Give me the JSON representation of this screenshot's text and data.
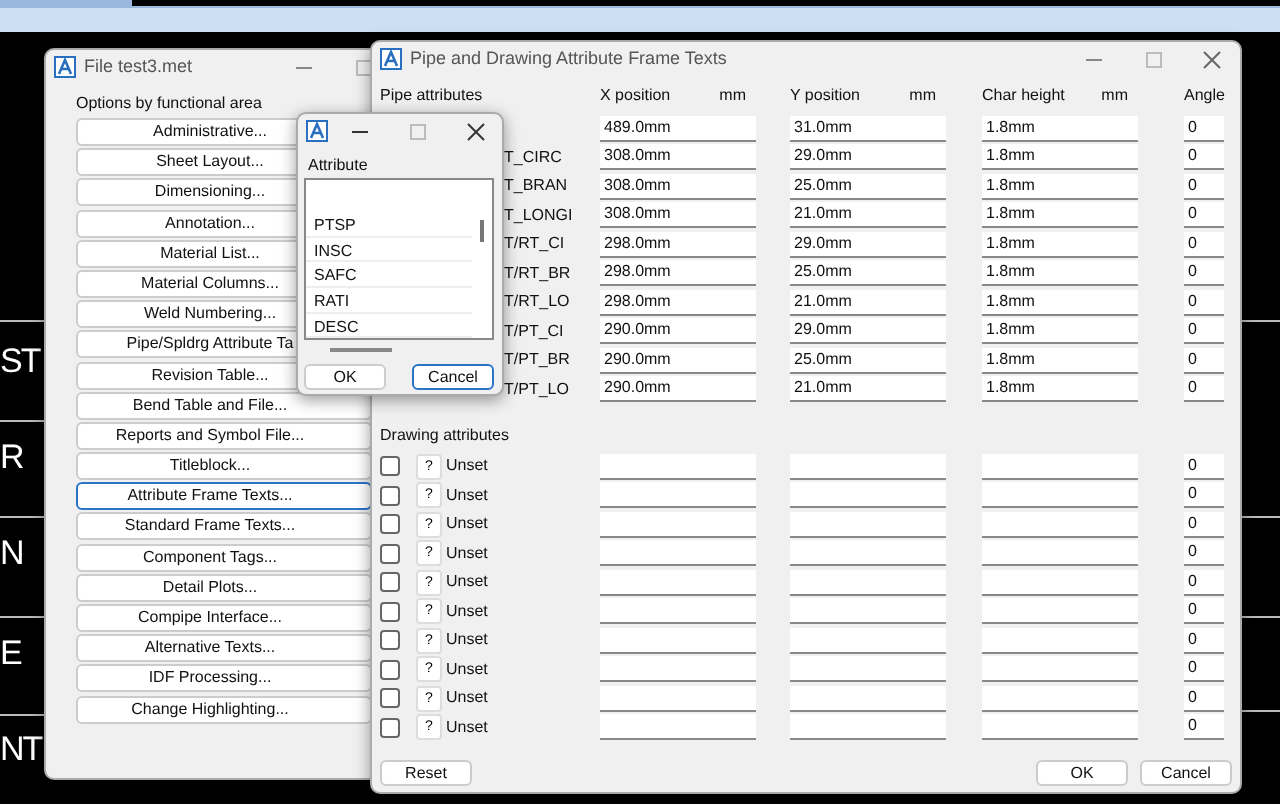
{
  "desktop": {
    "cad_texts": [
      "ST",
      "R",
      "N",
      "E",
      "NT"
    ]
  },
  "file_window": {
    "title": "File test3.met",
    "heading": "Options by functional area",
    "buttons": [
      {
        "label": "Administrative...",
        "focused": false
      },
      {
        "label": "Sheet Layout...",
        "focused": false
      },
      {
        "label": "Dimensioning...",
        "focused": false
      },
      {
        "label": "Annotation...",
        "focused": false
      },
      {
        "label": "Material List...",
        "focused": false
      },
      {
        "label": "Material Columns...",
        "focused": false
      },
      {
        "label": "Weld Numbering...",
        "focused": false
      },
      {
        "label": "Pipe/Spldrg Attribute Ta",
        "focused": false
      },
      {
        "label": "Revision Table...",
        "focused": false
      },
      {
        "label": "Bend Table and File...",
        "focused": false
      },
      {
        "label": "Reports and Symbol File...",
        "focused": false
      },
      {
        "label": "Titleblock...",
        "focused": false
      },
      {
        "label": "Attribute Frame Texts...",
        "focused": true
      },
      {
        "label": "Standard Frame Texts...",
        "focused": false
      },
      {
        "label": "Component Tags...",
        "focused": false
      },
      {
        "label": "Detail Plots...",
        "focused": false
      },
      {
        "label": "Compipe Interface...",
        "focused": false
      },
      {
        "label": "Alternative Texts...",
        "focused": false
      },
      {
        "label": "IDF Processing...",
        "focused": false
      },
      {
        "label": "Change Highlighting...",
        "focused": false
      }
    ]
  },
  "frame_window": {
    "title": "Pipe and Drawing Attribute Frame Texts",
    "pipe_heading": "Pipe attributes",
    "columns": [
      {
        "label": "X position",
        "unit": "mm"
      },
      {
        "label": "Y position",
        "unit": "mm"
      },
      {
        "label": "Char height",
        "unit": "mm"
      },
      {
        "label": "Angle"
      }
    ],
    "pipe_rows": [
      {
        "x": "489.0mm",
        "y": "31.0mm",
        "height": "1.8mm",
        "angle": "0"
      },
      {
        "name": "T_CIRC",
        "x": "308.0mm",
        "y": "29.0mm",
        "height": "1.8mm",
        "angle": "0"
      },
      {
        "name": "T_BRAN",
        "x": "308.0mm",
        "y": "25.0mm",
        "height": "1.8mm",
        "angle": "0"
      },
      {
        "name": "T_LONGI",
        "x": "308.0mm",
        "y": "21.0mm",
        "height": "1.8mm",
        "angle": "0"
      },
      {
        "name": "T/RT_CI",
        "x": "298.0mm",
        "y": "29.0mm",
        "height": "1.8mm",
        "angle": "0"
      },
      {
        "name": "T/RT_BR",
        "x": "298.0mm",
        "y": "25.0mm",
        "height": "1.8mm",
        "angle": "0"
      },
      {
        "name": "T/RT_LO",
        "x": "298.0mm",
        "y": "21.0mm",
        "height": "1.8mm",
        "angle": "0"
      },
      {
        "name": "T/PT_CI",
        "x": "290.0mm",
        "y": "29.0mm",
        "height": "1.8mm",
        "angle": "0"
      },
      {
        "name": "T/PT_BR",
        "x": "290.0mm",
        "y": "25.0mm",
        "height": "1.8mm",
        "angle": "0"
      },
      {
        "name": "T/PT_LO",
        "x": "290.0mm",
        "y": "21.0mm",
        "height": "1.8mm",
        "angle": "0"
      }
    ],
    "drawing_heading": "Drawing attributes",
    "drawing_rows": [
      {
        "checked": false,
        "pick": "?",
        "name": "Unset",
        "angle": "0"
      },
      {
        "checked": false,
        "pick": "?",
        "name": "Unset",
        "angle": "0"
      },
      {
        "checked": false,
        "pick": "?",
        "name": "Unset",
        "angle": "0"
      },
      {
        "checked": false,
        "pick": "?",
        "name": "Unset",
        "angle": "0"
      },
      {
        "checked": false,
        "pick": "?",
        "name": "Unset",
        "angle": "0"
      },
      {
        "checked": false,
        "pick": "?",
        "name": "Unset",
        "angle": "0"
      },
      {
        "checked": false,
        "pick": "?",
        "name": "Unset",
        "angle": "0"
      },
      {
        "checked": false,
        "pick": "?",
        "name": "Unset",
        "angle": "0"
      },
      {
        "checked": false,
        "pick": "?",
        "name": "Unset",
        "angle": "0"
      },
      {
        "checked": false,
        "pick": "?",
        "name": "Unset",
        "angle": "0"
      }
    ],
    "buttons": [
      {
        "label": "Reset",
        "kind": "left"
      },
      {
        "label": "OK",
        "kind": "right"
      },
      {
        "label": "Cancel",
        "kind": "right"
      }
    ]
  },
  "attribute_popup": {
    "label": "Attribute",
    "items": [
      "PTSP",
      "INSC",
      "SAFC",
      "RATI",
      "DESC"
    ],
    "buttons": [
      {
        "label": "OK",
        "focused": false
      },
      {
        "label": "Cancel",
        "focused": true
      }
    ]
  }
}
